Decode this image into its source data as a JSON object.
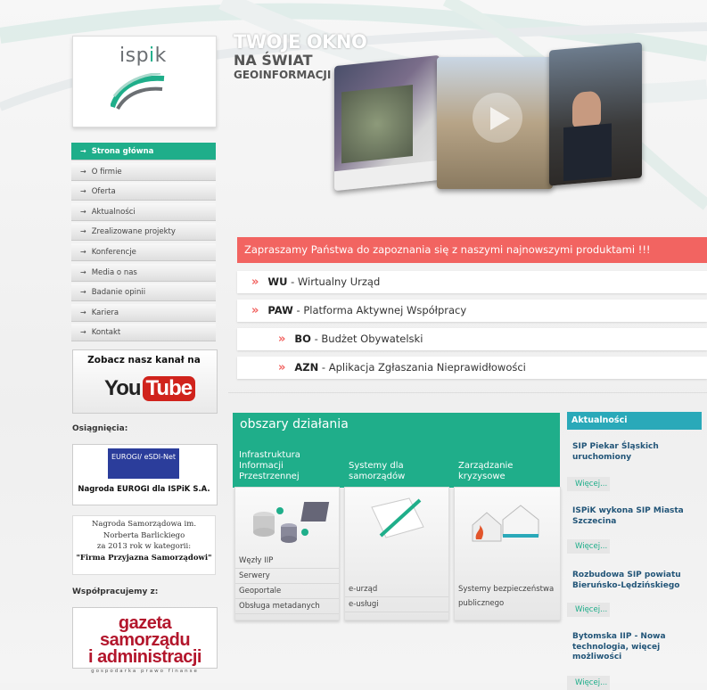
{
  "logo": {
    "text_a": "isp",
    "text_b": "i",
    "text_c": "k"
  },
  "nav": [
    {
      "label": "Strona główna",
      "active": true
    },
    {
      "label": "O firmie"
    },
    {
      "label": "Oferta"
    },
    {
      "label": "Aktualności"
    },
    {
      "label": "Zrealizowane projekty"
    },
    {
      "label": "Konferencje"
    },
    {
      "label": "Media o nas"
    },
    {
      "label": "Badanie opinii"
    },
    {
      "label": "Kariera"
    },
    {
      "label": "Kontakt"
    }
  ],
  "youtube": {
    "label": "Zobacz nasz kanał na",
    "you": "You",
    "tube": "Tube"
  },
  "achievements": {
    "heading": "Osiągnięcia:",
    "eurogi_logo": "EUROGI/ eSDI-Net",
    "award": "Nagroda EUROGI dla ISPiK S.A.",
    "barlicki_lines": [
      "Nagroda Samorządowa im.",
      "Norberta Barlickiego",
      "za 2013 rok w kategorii:"
    ],
    "barlicki_category": "\"Firma Przyjazna Samorządowi\""
  },
  "partners": {
    "heading": "Współpracujemy z:",
    "gazeta_line1": "gazeta samorządu",
    "gazeta_line2": "i administracji",
    "gazeta_sub": "gospodarka prawo finanse"
  },
  "hero": {
    "line1": "TWOJE OKNO",
    "line2": "NA ŚWIAT",
    "line3": "GEOINFORMACJI"
  },
  "banner": "Zapraszamy Państwa do zapoznania się z naszymi najnowszymi produktami !!!",
  "products": [
    {
      "abbr": "WU",
      "name": " - Wirtualny Urząd"
    },
    {
      "abbr": "PAW",
      "name": " - Platforma Aktywnej Współpracy"
    },
    {
      "abbr": "BO",
      "name": " - Budżet Obywatelski"
    },
    {
      "abbr": "AZN",
      "name": " - Aplikacja Zgłaszania Nieprawidłowości"
    }
  ],
  "areas": {
    "title": "obszary działania",
    "columns": [
      {
        "label": "Infrastruktura Informacji Przestrzennej",
        "links": [
          "Węzły IIP",
          "Serwery",
          "Geoportale",
          "Obsługa metadanych"
        ]
      },
      {
        "label": "Systemy dla samorządów",
        "links": [
          "e-urząd",
          "e-usługi"
        ]
      },
      {
        "label": "Zarządzanie kryzysowe",
        "links": [
          "Systemy bezpieczeństwa",
          "publicznego"
        ]
      }
    ]
  },
  "news": {
    "heading": "Aktualności",
    "more_label": "Więcej...",
    "items": [
      {
        "title": "SIP Piekar Śląskich uruchomiony"
      },
      {
        "title": "ISPiK wykona SIP Miasta Szczecina"
      },
      {
        "title": "Rozbudowa SIP powiatu Bieruńsko-Lędzińskiego"
      },
      {
        "title": "Bytomska IIP - Nowa technologia, więcej możliwości"
      }
    ]
  },
  "colors": {
    "accent": "#1fae8a",
    "banner": "#f26461",
    "news": "#2aa9b9"
  }
}
